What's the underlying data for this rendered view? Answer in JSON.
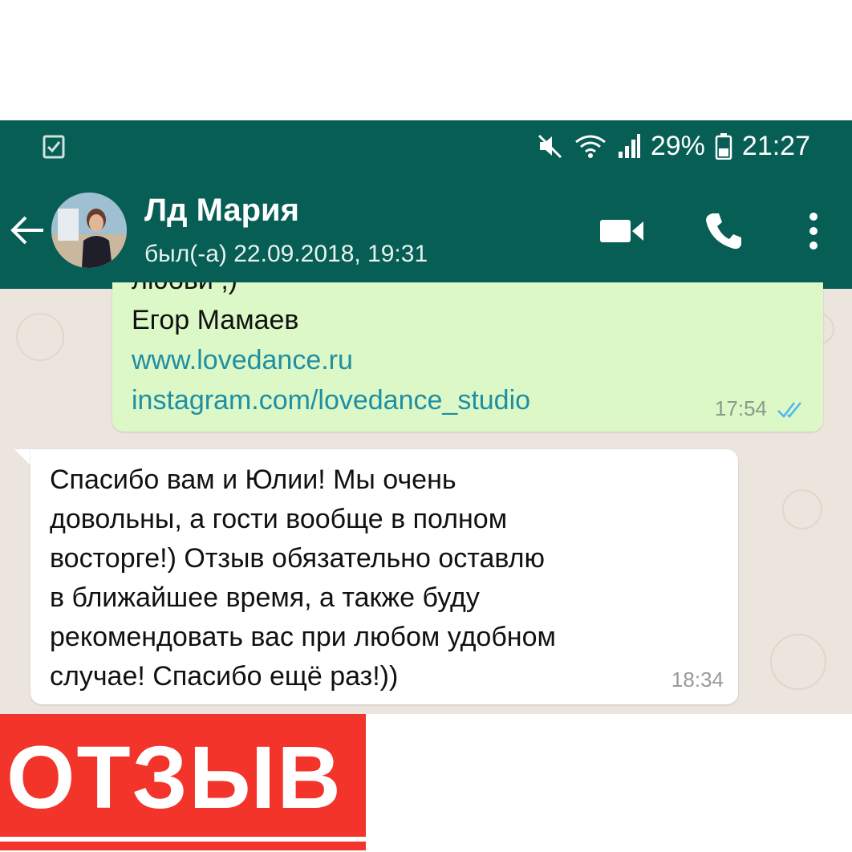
{
  "status_bar": {
    "battery": "29%",
    "time": "21:27",
    "icons": [
      "task-icon",
      "mute-icon",
      "wifi-icon",
      "signal-icon",
      "battery-icon"
    ]
  },
  "header": {
    "contact_name": "Лд Мария",
    "last_seen": "был(-а) 22.09.2018, 19:31",
    "icons": [
      "back-arrow-icon",
      "avatar",
      "video-call-icon",
      "phone-icon",
      "more-vert-icon"
    ]
  },
  "messages": [
    {
      "direction": "outgoing",
      "cut_line": "любви ;)",
      "signature": "Егор Мамаев",
      "link1": "www.lovedance.ru",
      "link2": "instagram.com/lovedance_studio",
      "time": "17:54",
      "read_receipt": "double-check-icon"
    },
    {
      "direction": "incoming",
      "text": "Спасибо вам и Юлии! Мы очень\nдовольны, а гости вообще в полном\nвосторге!) Отзыв обязательно оставлю\nв ближайшее время, а также буду\nрекомендовать вас при любом удобном\nслучае! Спасибо ещё раз!))",
      "time": "18:34"
    }
  ],
  "banner": {
    "label": "ОТЗЫВ"
  },
  "colors": {
    "header": "#075E54",
    "outgoing_bubble": "#DCF8C6",
    "chat_background": "#ECE5DD",
    "link": "#1f8fa4",
    "banner": "#f2342a"
  }
}
